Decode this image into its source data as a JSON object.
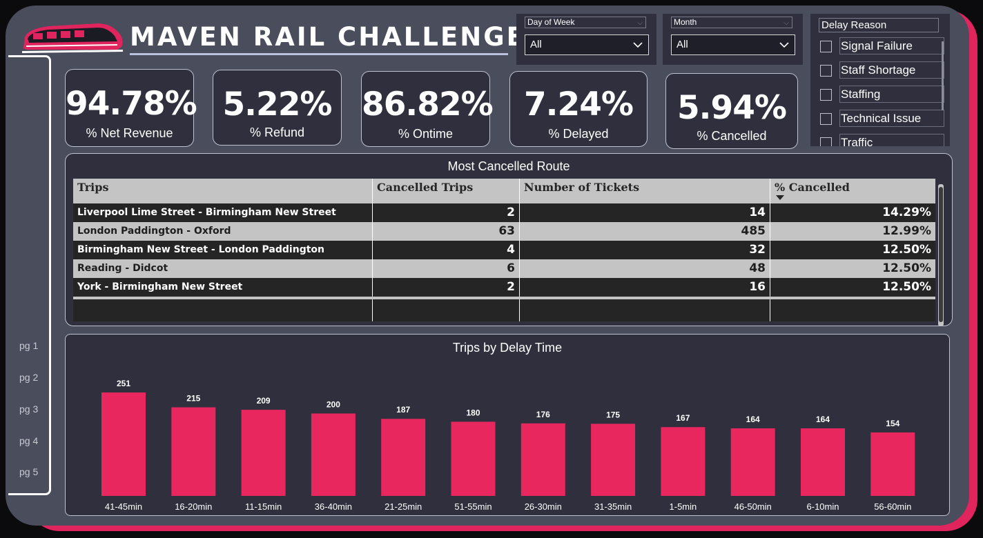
{
  "header": {
    "title": "MAVEN RAIL CHALLENGE"
  },
  "filters": {
    "day_of_week": {
      "label": "Day of Week",
      "value": "All"
    },
    "month": {
      "label": "Month",
      "value": "All"
    },
    "delay_reason": {
      "label": "Delay Reason",
      "options": [
        "Signal Failure",
        "Staff Shortage",
        "Staffing",
        "Technical Issue",
        "Traffic"
      ]
    }
  },
  "nav": {
    "pages": [
      "pg 1",
      "pg 2",
      "pg 3",
      "pg 4",
      "pg 5"
    ]
  },
  "kpis": [
    {
      "value": "94.78%",
      "label": "% Net Revenue"
    },
    {
      "value": "5.22%",
      "label": "% Refund"
    },
    {
      "value": "86.82%",
      "label": "% Ontime"
    },
    {
      "value": "7.24%",
      "label": "% Delayed"
    },
    {
      "value": "5.94%",
      "label": "% Cancelled"
    }
  ],
  "cancelled_table": {
    "title": "Most Cancelled Route",
    "columns": [
      "Trips",
      "Cancelled Trips",
      "Number of Tickets",
      "% Cancelled"
    ],
    "sorted_column": "% Cancelled",
    "rows": [
      {
        "trip": "Liverpool Lime Street - Birmingham New Street",
        "cancelled": "2",
        "tickets": "14",
        "pct": "14.29%"
      },
      {
        "trip": "London Paddington - Oxford",
        "cancelled": "63",
        "tickets": "485",
        "pct": "12.99%"
      },
      {
        "trip": "Birmingham New Street - London Paddington",
        "cancelled": "4",
        "tickets": "32",
        "pct": "12.50%"
      },
      {
        "trip": "Reading - Didcot",
        "cancelled": "6",
        "tickets": "48",
        "pct": "12.50%"
      },
      {
        "trip": "York - Birmingham New Street",
        "cancelled": "2",
        "tickets": "16",
        "pct": "12.50%"
      }
    ]
  },
  "chart_data": {
    "type": "bar",
    "title": "Trips by Delay Time",
    "categories": [
      "41-45min",
      "16-20min",
      "11-15min",
      "36-40min",
      "21-25min",
      "51-55min",
      "26-30min",
      "31-35min",
      "1-5min",
      "46-50min",
      "6-10min",
      "56-60min"
    ],
    "values": [
      251,
      215,
      209,
      200,
      187,
      180,
      176,
      175,
      167,
      164,
      164,
      154
    ],
    "data_labels": true,
    "bar_color": "#e8275f",
    "ylim": [
      0,
      251
    ],
    "xlabel": "",
    "ylabel": ""
  },
  "colors": {
    "accent": "#e0245e",
    "background": "#4a4d5c",
    "card": "#2f2f3d",
    "bar": "#e8275f"
  }
}
